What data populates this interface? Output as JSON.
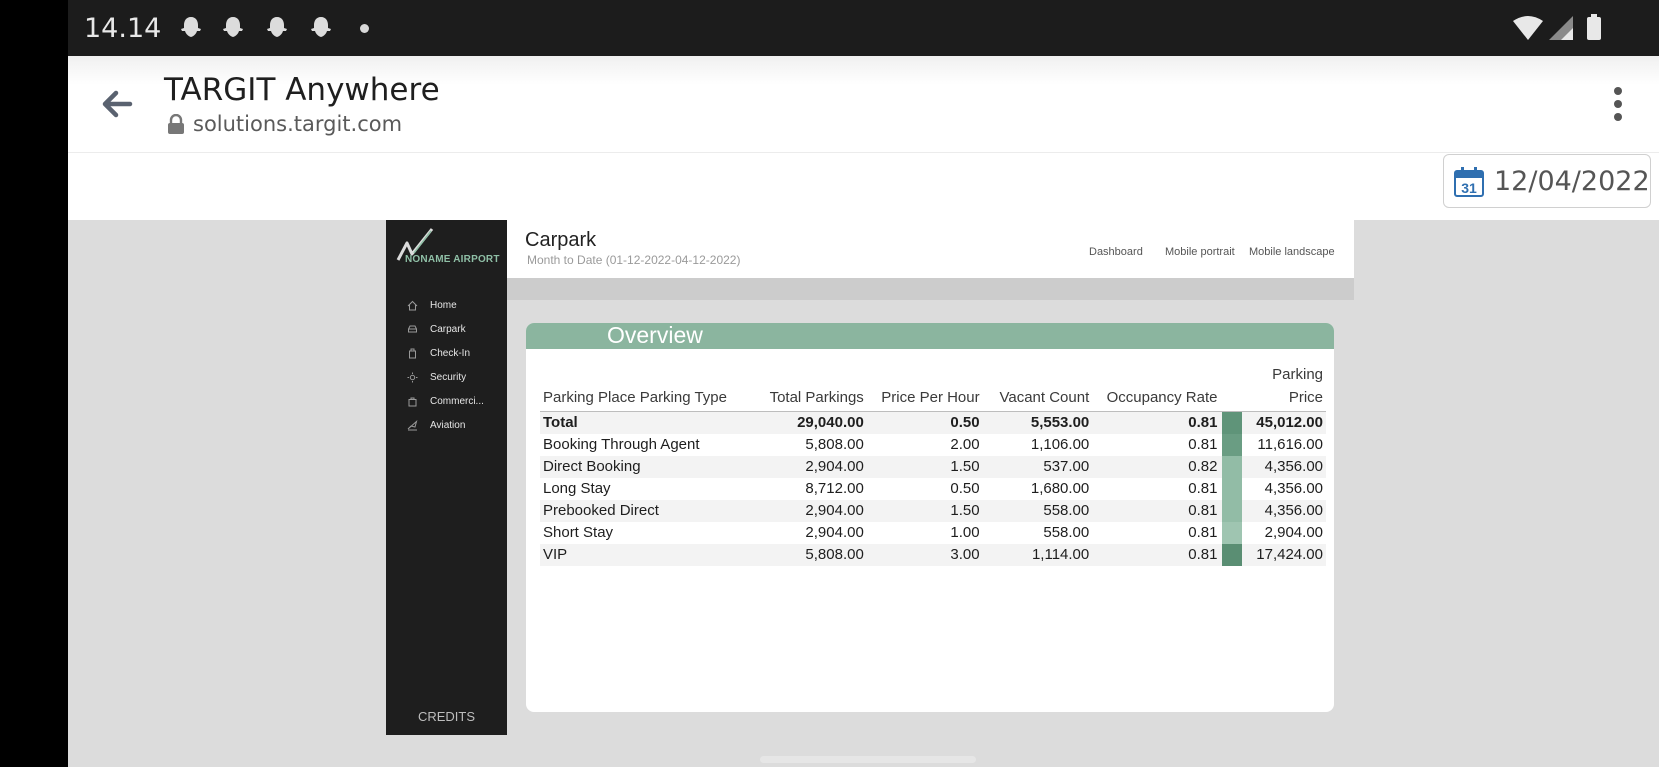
{
  "status_bar": {
    "time": "14.14"
  },
  "browser": {
    "title": "TARGIT Anywhere",
    "url": "solutions.targit.com"
  },
  "date_picker": {
    "value": "12/04/2022",
    "calendar_day": "31"
  },
  "brand": {
    "logo_text": "NONAME AIRPORT"
  },
  "sidebar": {
    "items": [
      {
        "label": "Home",
        "icon": "home-icon"
      },
      {
        "label": "Carpark",
        "icon": "car-icon"
      },
      {
        "label": "Check-In",
        "icon": "luggage-icon"
      },
      {
        "label": "Security",
        "icon": "security-icon"
      },
      {
        "label": "Commerci...",
        "icon": "shopping-bag-icon"
      },
      {
        "label": "Aviation",
        "icon": "plane-icon"
      }
    ],
    "credits": "CREDITS"
  },
  "dashboard": {
    "title": "Carpark",
    "subtitle": "Month to Date (01-12-2022-04-12-2022)",
    "views": [
      "Dashboard",
      "Mobile portrait",
      "Mobile landscape"
    ]
  },
  "overview": {
    "title": "Overview",
    "headers": [
      "Parking Place Parking Type",
      "Total Parkings",
      "Price Per Hour",
      "Vacant Count",
      "Occupancy Rate",
      "Parking Price"
    ],
    "rows": [
      [
        "Total",
        "29,040.00",
        "0.50",
        "5,553.00",
        "0.81",
        "45,012.00"
      ],
      [
        "Booking Through Agent",
        "5,808.00",
        "2.00",
        "1,106.00",
        "0.81",
        "11,616.00"
      ],
      [
        "Direct Booking",
        "2,904.00",
        "1.50",
        "537.00",
        "0.82",
        "4,356.00"
      ],
      [
        "Long Stay",
        "8,712.00",
        "0.50",
        "1,680.00",
        "0.81",
        "4,356.00"
      ],
      [
        "Prebooked Direct",
        "2,904.00",
        "1.50",
        "558.00",
        "0.81",
        "4,356.00"
      ],
      [
        "Short Stay",
        "2,904.00",
        "1.00",
        "558.00",
        "0.81",
        "2,904.00"
      ],
      [
        "VIP",
        "5,808.00",
        "3.00",
        "1,114.00",
        "0.81",
        "17,424.00"
      ]
    ],
    "swatch_colors": [
      "#5f9479",
      "#6a9d83",
      "#92bca6",
      "#92bca6",
      "#92bca6",
      "#9fc5b1",
      "#5a8e73"
    ]
  },
  "colors": {
    "accent": "#8bb59f",
    "sidebar": "#1e1e1e"
  }
}
